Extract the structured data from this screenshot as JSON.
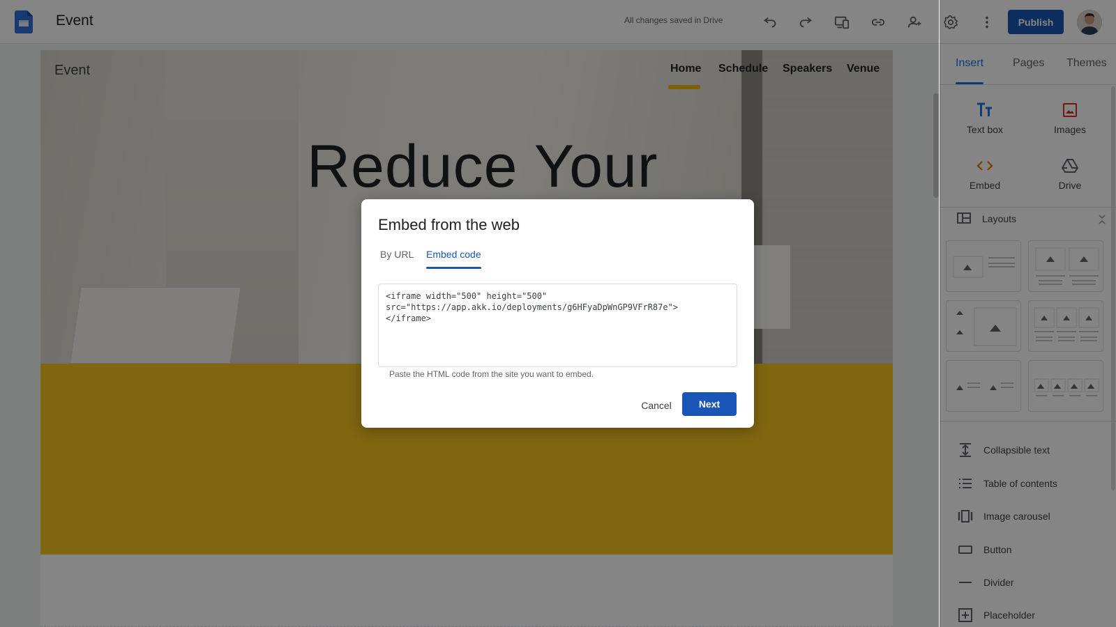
{
  "app": {
    "title": "Event",
    "save_status": "All changes saved in Drive",
    "publish_label": "Publish"
  },
  "toolbar": {
    "icons": [
      "undo-icon",
      "redo-icon",
      "preview-icon",
      "link-icon",
      "share-icon",
      "settings-icon",
      "more-icon"
    ]
  },
  "site": {
    "name": "Event",
    "nav": [
      "Home",
      "Schedule",
      "Speakers",
      "Venue"
    ],
    "active_nav": "Home",
    "hero_title": "Reduce Your",
    "accent_color": "#f5c322"
  },
  "panel": {
    "tabs": [
      "Insert",
      "Pages",
      "Themes"
    ],
    "active_tab": "Insert",
    "insert_items": [
      "Text box",
      "Images",
      "Embed",
      "Drive"
    ],
    "layouts_label": "Layouts",
    "components": [
      "Collapsible text",
      "Table of contents",
      "Image carousel",
      "Button",
      "Divider",
      "Placeholder"
    ]
  },
  "dialog": {
    "title": "Embed from the web",
    "tabs": [
      "By URL",
      "Embed code"
    ],
    "active_tab": "Embed code",
    "code": "<iframe width=\"500\" height=\"500\"\nsrc=\"https://app.akk.io/deployments/g6HFyaDpWnGP9VFrR87e\">\n</iframe>",
    "helper": "Paste the HTML code from the site you want to embed.",
    "cancel_label": "Cancel",
    "next_label": "Next",
    "primary_color": "#1a56b7"
  }
}
